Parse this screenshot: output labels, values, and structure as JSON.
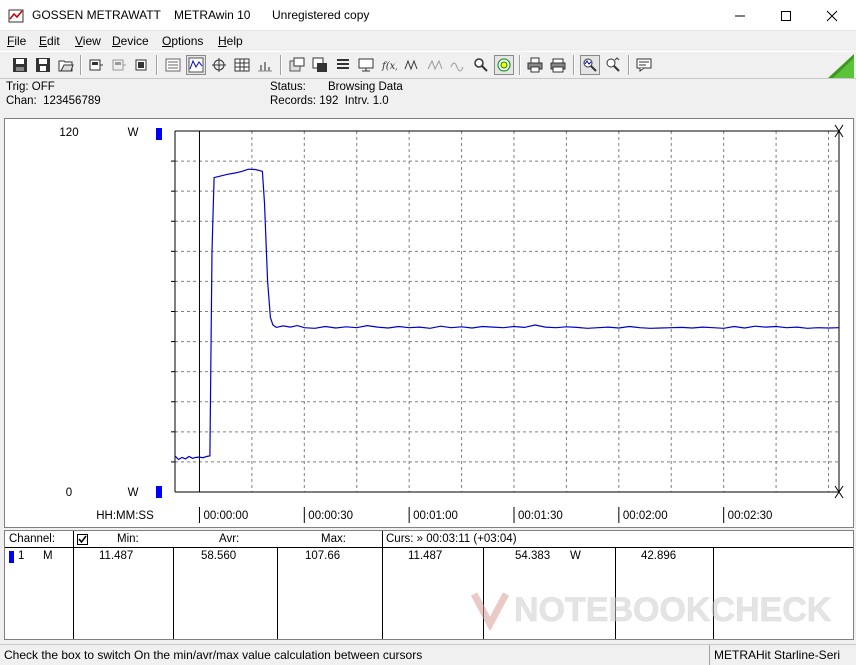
{
  "window": {
    "company": "GOSSEN METRAWATT",
    "app": "METRAwin 10",
    "license": "Unregistered copy"
  },
  "menu": [
    {
      "label": "File"
    },
    {
      "label": "Edit"
    },
    {
      "label": "View"
    },
    {
      "label": "Device"
    },
    {
      "label": "Options"
    },
    {
      "label": "Help"
    }
  ],
  "info": {
    "trig": "Trig: OFF",
    "chan": "Chan:  123456789",
    "status_label": "Status:",
    "status_value": "Browsing Data",
    "records": "Records: 192  Intrv. 1.0"
  },
  "chart_data": {
    "type": "line",
    "y_top_label": "120",
    "y_bottom_label": "0",
    "y_unit": "W",
    "ylim": [
      0,
      120
    ],
    "x_axis_label": "HH:MM:SS",
    "x_ticks": [
      "00:00:00",
      "00:00:30",
      "00:01:00",
      "00:01:30",
      "00:02:00",
      "00:02:30"
    ],
    "xlim_seconds": [
      -7,
      183
    ],
    "grid": true,
    "line_color": "#0000cc",
    "series": [
      {
        "x": [
          -7,
          -6,
          -5,
          -4,
          -3,
          -2,
          -1,
          0,
          1,
          2,
          3,
          3.6,
          4.2,
          6,
          8,
          10,
          12,
          14,
          16,
          18,
          18.6,
          19.5,
          20.3,
          21,
          22,
          24,
          26,
          28,
          30,
          33,
          36,
          39,
          42,
          45,
          48,
          51,
          54,
          57,
          60,
          63,
          66,
          69,
          72,
          75,
          78,
          81,
          84,
          87,
          90,
          93,
          96,
          99,
          102,
          105,
          108,
          111,
          114,
          117,
          120,
          123,
          126,
          129,
          132,
          135,
          138,
          141,
          144,
          147,
          150,
          153,
          156,
          159,
          162,
          165,
          168,
          171,
          174,
          177,
          180,
          183
        ],
        "values": [
          12.0,
          10.8,
          11.5,
          11.0,
          11.8,
          11.2,
          11.5,
          11.6,
          11.4,
          11.8,
          12.0,
          80,
          104.5,
          105,
          105.6,
          106,
          106.5,
          107.3,
          107.2,
          106.6,
          96,
          70,
          58,
          55.5,
          54.7,
          55.2,
          54.8,
          55.3,
          54.6,
          54.4,
          55.0,
          54.5,
          54.9,
          54.6,
          55.3,
          54.8,
          54.5,
          55.0,
          54.6,
          54.8,
          54.4,
          55.1,
          54.6,
          54.9,
          54.5,
          55.0,
          54.8,
          54.6,
          55.0,
          54.7,
          55.5,
          54.8,
          54.6,
          54.9,
          54.7,
          54.4,
          54.6,
          54.8,
          54.5,
          55.0,
          54.6,
          54.4,
          54.5,
          54.6,
          54.7,
          54.5,
          54.8,
          54.6,
          54.4,
          55.0,
          54.5,
          55.1,
          54.8,
          55.0,
          54.6,
          54.8,
          54.4,
          54.6,
          54.5,
          54.6
        ]
      }
    ]
  },
  "table": {
    "headers": {
      "channel": "Channel:",
      "min": "Min:",
      "avr": "Avr:",
      "max": "Max:",
      "curs": "Curs: » 00:03:11 (+03:04)"
    },
    "row": {
      "num": "1",
      "type": "M",
      "min": "11.487",
      "avr": "58.560",
      "max": "107.66",
      "curs1": "11.487",
      "curs2": "54.383",
      "unit": "W",
      "curs3": "42.896"
    }
  },
  "status": {
    "left": "Check the box to switch On the min/avr/max value calculation between cursors",
    "right": "METRAHit Starline-Seri"
  },
  "watermark": "NOTEBOOKCHECK",
  "icons": [
    "app-icon",
    "save-icon",
    "save-all-icon",
    "open-icon",
    "device-icon",
    "device-gray-icon",
    "device2-icon",
    "chart-list-icon",
    "waveform-icon",
    "crosshair-icon",
    "table-icon",
    "histogram-icon",
    "export-icon",
    "import-icon",
    "list-icon",
    "monitor-icon",
    "fx-icon",
    "wave-a-icon",
    "wave-b-icon",
    "wave-c-icon",
    "search-icon",
    "target-icon",
    "print-icon",
    "print-preview-icon",
    "zoom-icon",
    "zoom-reset-icon",
    "comment-icon",
    "corner-triangle-icon"
  ]
}
